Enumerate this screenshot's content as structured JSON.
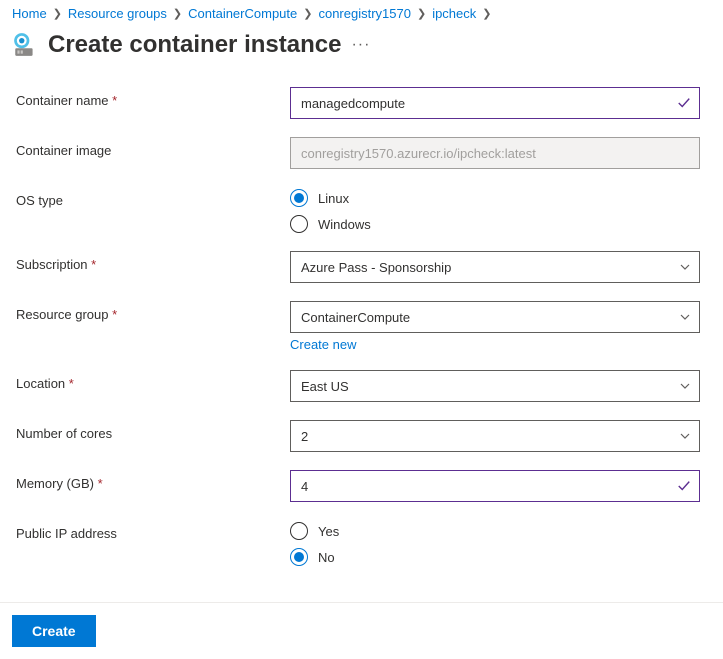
{
  "breadcrumb": {
    "items": [
      "Home",
      "Resource groups",
      "ContainerCompute",
      "conregistry1570",
      "ipcheck"
    ]
  },
  "header": {
    "title": "Create container instance"
  },
  "form": {
    "container_name": {
      "label": "Container name",
      "value": "managedcompute",
      "required": true
    },
    "container_image": {
      "label": "Container image",
      "value": "conregistry1570.azurecr.io/ipcheck:latest",
      "required": false
    },
    "os_type": {
      "label": "OS type",
      "options": [
        "Linux",
        "Windows"
      ],
      "selected": "Linux"
    },
    "subscription": {
      "label": "Subscription",
      "value": "Azure Pass - Sponsorship",
      "required": true
    },
    "resource_group": {
      "label": "Resource group",
      "value": "ContainerCompute",
      "required": true,
      "create_new": "Create new"
    },
    "location": {
      "label": "Location",
      "value": "East US",
      "required": true
    },
    "cores": {
      "label": "Number of cores",
      "value": "2"
    },
    "memory": {
      "label": "Memory (GB)",
      "value": "4",
      "required": true
    },
    "public_ip": {
      "label": "Public IP address",
      "options": [
        "Yes",
        "No"
      ],
      "selected": "No"
    }
  },
  "footer": {
    "create": "Create"
  }
}
